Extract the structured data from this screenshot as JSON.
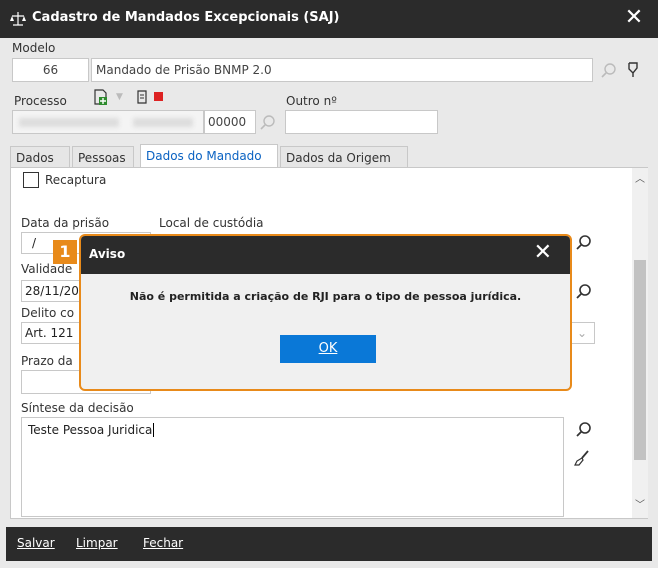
{
  "window": {
    "title": "Cadastro de Mandados Excepcionais (SAJ)",
    "close_glyph": "✕"
  },
  "modelo": {
    "label": "Modelo",
    "code": "66",
    "name": "Mandado de Prisão BNMP 2.0"
  },
  "processo": {
    "label": "Processo",
    "suffix": "00000",
    "outro_label": "Outro nº",
    "outro_value": ""
  },
  "tabs": [
    {
      "label": "Dados"
    },
    {
      "label": "Pessoas"
    },
    {
      "label": "Dados do Mandado"
    },
    {
      "label": "Dados da Origem"
    }
  ],
  "form": {
    "recaptura_label": "Recaptura",
    "data_prisao_label": "Data da prisão",
    "data_prisao_value": "/",
    "local_custodia_label": "Local de custódia",
    "validade_label": "Validade",
    "validade_value": "28/11/20",
    "delito_label": "Delito co",
    "delito_value": "Art. 121",
    "prazo_label": "Prazo da",
    "sintese_label": "Síntese da decisão",
    "sintese_value": "Teste Pessoa Juridica"
  },
  "dialog": {
    "badge": "1",
    "title": "Aviso",
    "message": "Não é permitida a criação de RJI para o tipo de pessoa jurídica.",
    "ok_label": "OK"
  },
  "footer": {
    "save": "Salvar",
    "clear": "Limpar",
    "close": "Fechar"
  },
  "colors": {
    "accent": "#0a78d7",
    "highlight": "#e88a1a",
    "titlebar": "#2b2b2b"
  }
}
